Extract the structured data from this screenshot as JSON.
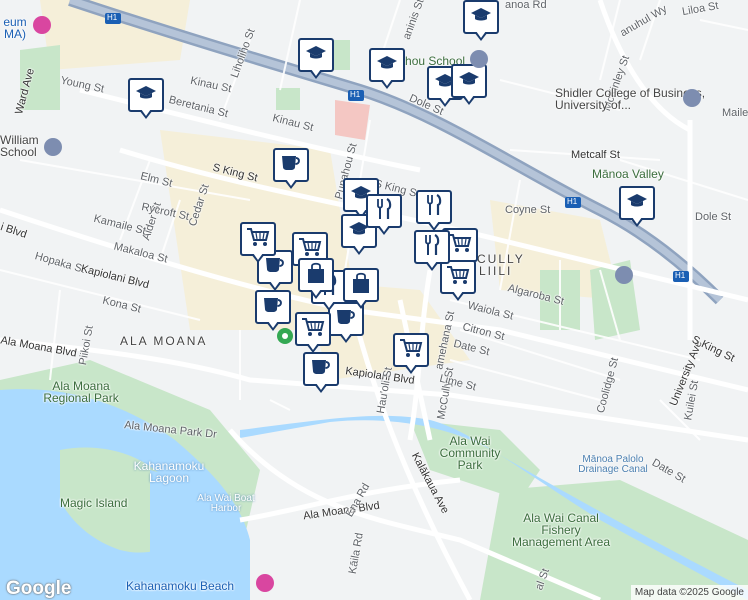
{
  "map": {
    "streets": [
      {
        "id": "young",
        "text": "Young St"
      },
      {
        "id": "beretania",
        "text": "Beretania St"
      },
      {
        "id": "kinau1",
        "text": "Kinau St"
      },
      {
        "id": "kinau2",
        "text": "Kinau St"
      },
      {
        "id": "liholiho",
        "text": "Liholiho St"
      },
      {
        "id": "dole1",
        "text": "Dole St"
      },
      {
        "id": "dole2",
        "text": "Dole St"
      },
      {
        "id": "metcalf",
        "text": "Metcalf St"
      },
      {
        "id": "coyne",
        "text": "Coyne St"
      },
      {
        "id": "punahou",
        "text": "Punahou St"
      },
      {
        "id": "sking1",
        "text": "S King St"
      },
      {
        "id": "sking2",
        "text": "S King St"
      },
      {
        "id": "elm",
        "text": "Elm St"
      },
      {
        "id": "alder",
        "text": "Alder St"
      },
      {
        "id": "cedar",
        "text": "Cedar St"
      },
      {
        "id": "rycroft",
        "text": "Rycroft St"
      },
      {
        "id": "kamaile",
        "text": "Kamaile St"
      },
      {
        "id": "makaloa",
        "text": "Makaloa St"
      },
      {
        "id": "hopaka",
        "text": "Hopaka St"
      },
      {
        "id": "kapiolani1",
        "text": "Kapiolani Blvd"
      },
      {
        "id": "kapiolani2",
        "text": "Kapiolani Blvd"
      },
      {
        "id": "kona",
        "text": "Kona St"
      },
      {
        "id": "piikoi",
        "text": "Piikoi St"
      },
      {
        "id": "alamoana1",
        "text": "Ala Moana Blvd"
      },
      {
        "id": "alamoanapark",
        "text": "Ala Moana Park Dr"
      },
      {
        "id": "alamoana2",
        "text": "Ala Moana Blvd"
      },
      {
        "id": "wardave",
        "text": "Ward Ave"
      },
      {
        "id": "kilblvd",
        "text": "i Blvd"
      },
      {
        "id": "hauoli",
        "text": "Hau'oli St"
      },
      {
        "id": "mccully",
        "text": "McCully St"
      },
      {
        "id": "kamehameha",
        "text": "amehana St"
      },
      {
        "id": "waiola",
        "text": "Waiola St"
      },
      {
        "id": "citron",
        "text": "Citron St"
      },
      {
        "id": "date1",
        "text": "Date St"
      },
      {
        "id": "date2",
        "text": "Date St"
      },
      {
        "id": "algaroba",
        "text": "Algaroba St"
      },
      {
        "id": "lime",
        "text": "Lime St"
      },
      {
        "id": "coolidge",
        "text": "Coolidge St"
      },
      {
        "id": "univ",
        "text": "University Ave"
      },
      {
        "id": "sking3",
        "text": "S King St"
      },
      {
        "id": "kuilei",
        "text": "Kuilei St"
      },
      {
        "id": "kalakaua",
        "text": "Kalākaua Ave"
      },
      {
        "id": "kaiolu",
        "text": "Ena Rd"
      },
      {
        "id": "kaila",
        "text": "Kāila Rd"
      },
      {
        "id": "mckinley",
        "text": "McKinley St"
      },
      {
        "id": "liloa",
        "text": "Liloa St"
      },
      {
        "id": "manoard",
        "text": "anoa Rd"
      },
      {
        "id": "kanuhulhu",
        "text": "anuhul Wy"
      },
      {
        "id": "aninis",
        "text": "aninis St"
      },
      {
        "id": "maile",
        "text": "Maile"
      },
      {
        "id": "ekalst",
        "text": "al St"
      }
    ],
    "places": [
      {
        "id": "shidler",
        "text": "Shidler College of Business, University of..."
      },
      {
        "id": "manoavalley",
        "text": "Mānoa Valley"
      },
      {
        "id": "punahouschool",
        "text": "Punahou School"
      },
      {
        "id": "william",
        "text": "William School"
      },
      {
        "id": "museum",
        "text": "eum MA)"
      },
      {
        "id": "alamoanapark",
        "text": "Ala Moana Regional Park"
      },
      {
        "id": "kahanamokulagoon",
        "text": "Kahanamoku Lagoon"
      },
      {
        "id": "magicisland",
        "text": "Magic Island"
      },
      {
        "id": "alawaiboat",
        "text": "Ala Wai Boat Harbor"
      },
      {
        "id": "alawaicommunity",
        "text": "Ala Wai Community Park"
      },
      {
        "id": "manoapalolo",
        "text": "Mānoa Palolo Drainage Canal"
      },
      {
        "id": "alawaifishery",
        "text": "Ala Wai Canal Fishery Management Area"
      },
      {
        "id": "kahanamokubeach",
        "text": "Kahanamoku Beach"
      },
      {
        "id": "alamoanadistrict",
        "text": "ALA MOANA"
      },
      {
        "id": "mccullydistrict",
        "text": "CULLY"
      },
      {
        "id": "moiliili",
        "text": "LIILI"
      }
    ],
    "shields": [
      {
        "id": "h1a",
        "text": "H1"
      },
      {
        "id": "h1b",
        "text": "H1"
      },
      {
        "id": "h1c",
        "text": "H1"
      },
      {
        "id": "h1d",
        "text": "H1"
      }
    ],
    "markers": [
      {
        "icon": "school-icon"
      },
      {
        "icon": "school-icon"
      },
      {
        "icon": "school-icon"
      },
      {
        "icon": "school-icon"
      },
      {
        "icon": "school-icon"
      },
      {
        "icon": "school-icon"
      },
      {
        "icon": "school-icon"
      },
      {
        "icon": "school-icon"
      },
      {
        "icon": "school-icon"
      },
      {
        "icon": "coffee-icon"
      },
      {
        "icon": "coffee-icon"
      },
      {
        "icon": "coffee-icon"
      },
      {
        "icon": "coffee-icon"
      },
      {
        "icon": "coffee-icon"
      },
      {
        "icon": "cart-icon"
      },
      {
        "icon": "cart-icon"
      },
      {
        "icon": "cart-icon"
      },
      {
        "icon": "cart-icon"
      },
      {
        "icon": "cart-icon"
      },
      {
        "icon": "cart-icon"
      },
      {
        "icon": "restaurant-icon"
      },
      {
        "icon": "restaurant-icon"
      },
      {
        "icon": "restaurant-icon"
      },
      {
        "icon": "restaurant-icon"
      },
      {
        "icon": "shopping-bag-icon"
      },
      {
        "icon": "shopping-bag-icon"
      }
    ],
    "logo": "Google",
    "attribution": "Map data ©2025 Google",
    "colors": {
      "land": "#f1f3f4",
      "water": "#aadaff",
      "park": "#c8e6c9",
      "highway": "#8fa3bf",
      "urban": "#f5efd9",
      "marker": "#1a3b6d"
    }
  }
}
